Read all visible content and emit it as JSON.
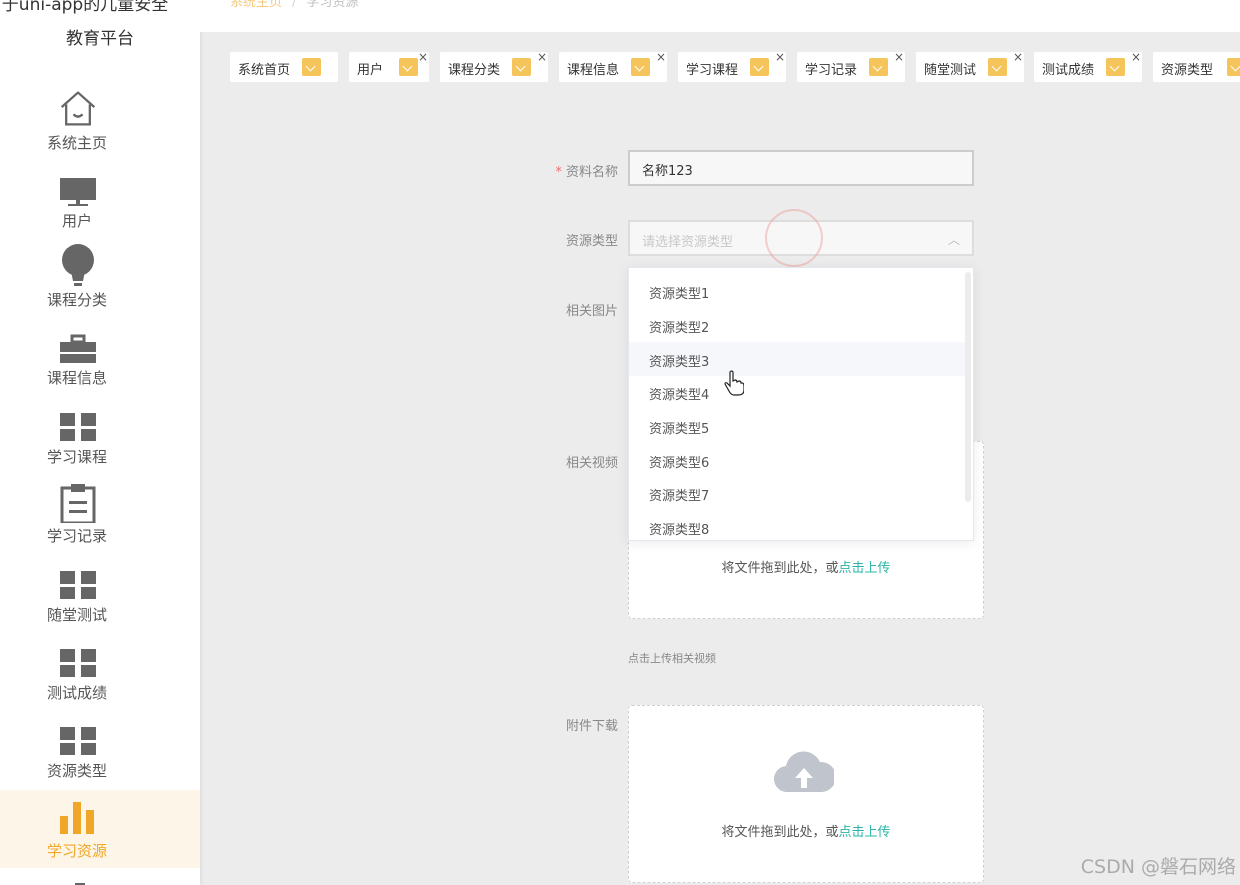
{
  "app": {
    "title_line1": "于uni-app的儿童安全",
    "title_line2": "教育平台"
  },
  "breadcrumb": {
    "home": "系统主页",
    "current": "学习资源"
  },
  "sidebar": {
    "items": [
      {
        "label": "系统主页",
        "icon": "home-icon"
      },
      {
        "label": "用户",
        "icon": "monitor-icon"
      },
      {
        "label": "课程分类",
        "icon": "lightbulb-icon"
      },
      {
        "label": "课程信息",
        "icon": "briefcase-icon"
      },
      {
        "label": "学习课程",
        "icon": "grid-icon"
      },
      {
        "label": "学习记录",
        "icon": "clipboard-icon"
      },
      {
        "label": "随堂测试",
        "icon": "grid-icon"
      },
      {
        "label": "测试成绩",
        "icon": "grid-icon"
      },
      {
        "label": "资源类型",
        "icon": "grid-icon"
      },
      {
        "label": "学习资源",
        "icon": "bar-chart-icon"
      }
    ]
  },
  "tags": [
    "系统首页",
    "用户",
    "课程分类",
    "课程信息",
    "学习课程",
    "学习记录",
    "随堂测试",
    "测试成绩",
    "资源类型"
  ],
  "form": {
    "name_label": "资料名称",
    "name_value": "名称123",
    "type_label": "资源类型",
    "type_placeholder": "请选择资源类型",
    "image_label": "相关图片",
    "video_label": "相关视频",
    "attachment_label": "附件下载",
    "upload_text": "将文件拖到此处，或",
    "upload_link": "点击上传",
    "video_hint": "点击上传相关视频"
  },
  "dropdown": {
    "options": [
      "资源类型1",
      "资源类型2",
      "资源类型3",
      "资源类型4",
      "资源类型5",
      "资源类型6",
      "资源类型7",
      "资源类型8"
    ],
    "hovered": "资源类型3"
  },
  "watermark": "CSDN @磐石网络",
  "colors": {
    "accent": "#f0a626",
    "link": "#2bb4a7",
    "icon_gray": "#666666"
  }
}
